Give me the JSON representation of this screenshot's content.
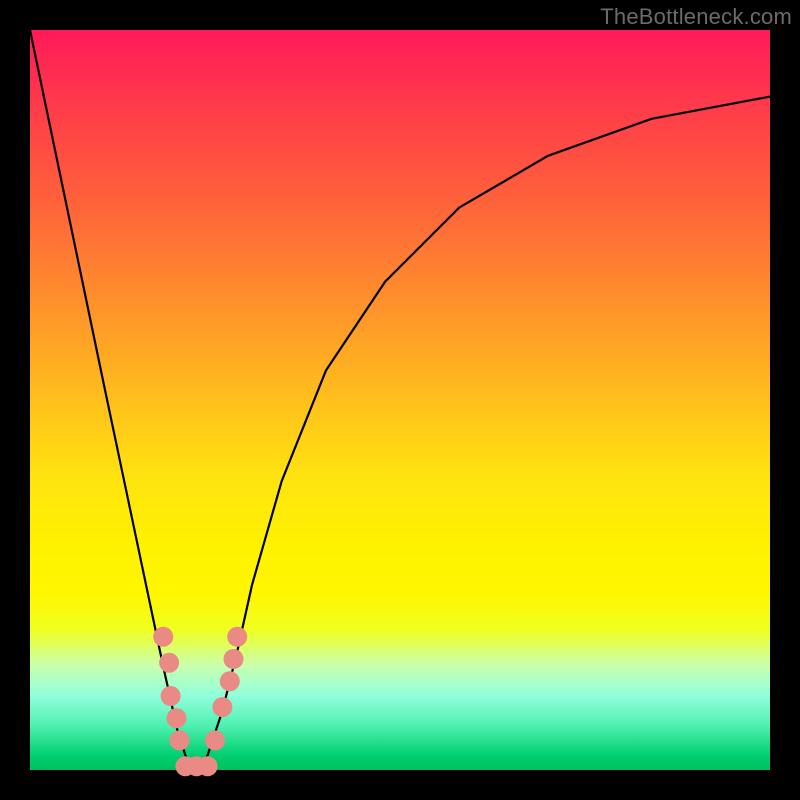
{
  "watermark": "TheBottleneck.com",
  "chart_data": {
    "type": "line",
    "title": "",
    "xlabel": "",
    "ylabel": "",
    "xlim": [
      0,
      100
    ],
    "ylim": [
      0,
      100
    ],
    "grid": false,
    "legend": false,
    "series": [
      {
        "name": "bottleneck-curve",
        "x": [
          0,
          5,
          10,
          14,
          18,
          20,
          21,
          22,
          23,
          24,
          26,
          28,
          30,
          34,
          40,
          48,
          58,
          70,
          84,
          100
        ],
        "values": [
          100,
          76,
          52,
          33,
          14,
          5,
          2,
          0,
          0,
          2,
          8,
          16,
          25,
          39,
          54,
          66,
          76,
          83,
          88,
          91
        ]
      }
    ],
    "markers": {
      "name": "highlighted-points",
      "color": "#e98a84",
      "radius": 10,
      "points": [
        {
          "x": 18.0,
          "y": 18.0
        },
        {
          "x": 18.8,
          "y": 14.5
        },
        {
          "x": 19.0,
          "y": 10.0
        },
        {
          "x": 19.8,
          "y": 7.0
        },
        {
          "x": 20.2,
          "y": 4.0
        },
        {
          "x": 21.0,
          "y": 0.5
        },
        {
          "x": 22.5,
          "y": 0.5
        },
        {
          "x": 24.0,
          "y": 0.5
        },
        {
          "x": 25.0,
          "y": 4.0
        },
        {
          "x": 26.0,
          "y": 8.5
        },
        {
          "x": 27.0,
          "y": 12.0
        },
        {
          "x": 27.5,
          "y": 15.0
        },
        {
          "x": 28.0,
          "y": 18.0
        }
      ]
    },
    "gradient_stops": [
      {
        "pos": 0.0,
        "color": "#ff1a5a"
      },
      {
        "pos": 0.22,
        "color": "#ff5e3c"
      },
      {
        "pos": 0.48,
        "color": "#ffb81e"
      },
      {
        "pos": 0.7,
        "color": "#fff200"
      },
      {
        "pos": 0.86,
        "color": "#c8ffb0"
      },
      {
        "pos": 1.0,
        "color": "#00c060"
      }
    ]
  }
}
